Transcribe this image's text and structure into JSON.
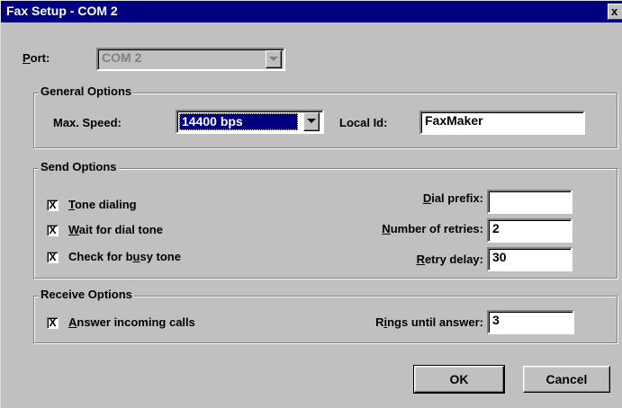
{
  "window": {
    "title": "Fax Setup - COM 2",
    "close_glyph": "x"
  },
  "port": {
    "label": "Port:",
    "label_mnemonic": "P",
    "label_rest": "ort:",
    "value": "COM 2"
  },
  "general": {
    "legend": "General Options",
    "speed_label": "Max. Speed:",
    "speed_value": "14400 bps",
    "local_id_label": "Local Id:",
    "local_id_value": "FaxMaker"
  },
  "send": {
    "legend": "Send Options",
    "checkboxes": [
      {
        "mnemonic": "T",
        "rest": "one dialing",
        "label": "Tone dialing",
        "checked": true
      },
      {
        "mnemonic": "W",
        "rest": "ait for dial tone",
        "label": "Wait for dial tone",
        "checked": true
      },
      {
        "pre": "Check for b",
        "mnemonic": "u",
        "rest": "sy tone",
        "label": "Check for busy tone",
        "checked": true
      }
    ],
    "dial_prefix": {
      "mnemonic": "D",
      "rest": "ial prefix:",
      "value": ""
    },
    "retries": {
      "mnemonic": "N",
      "rest": "umber of retries:",
      "value": "2"
    },
    "retry_delay": {
      "mnemonic": "R",
      "rest": "etry delay:",
      "value": "30"
    }
  },
  "receive": {
    "legend": "Receive Options",
    "answer": {
      "mnemonic": "A",
      "rest": "nswer incoming calls",
      "checked": true
    },
    "rings": {
      "pre": "R",
      "mnemonic": "i",
      "rest": "ngs until answer:",
      "value": "3"
    }
  },
  "buttons": {
    "ok": "OK",
    "cancel": "Cancel"
  },
  "check_mark": "X"
}
